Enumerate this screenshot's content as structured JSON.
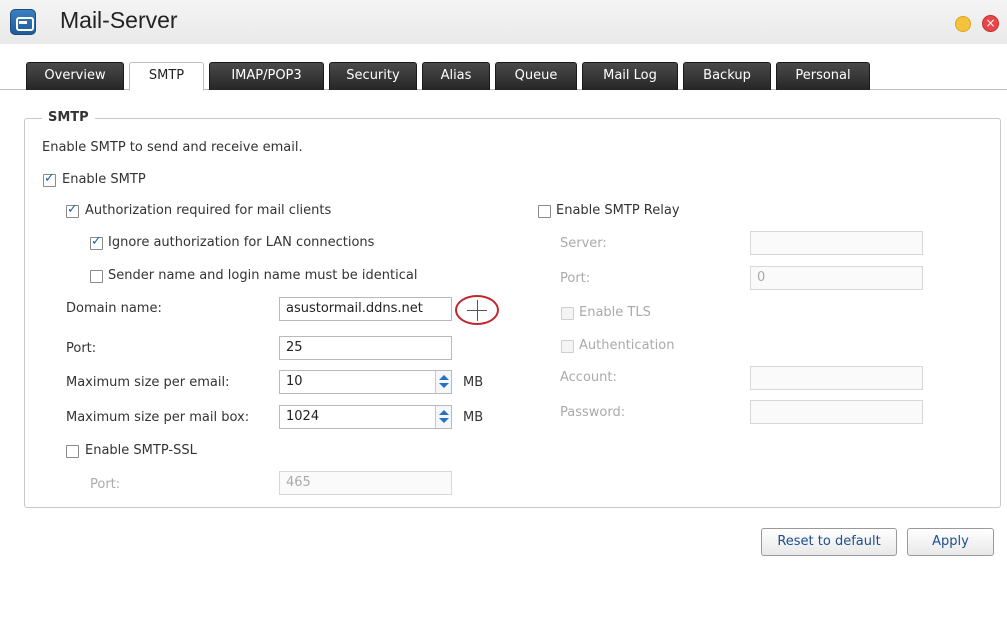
{
  "window": {
    "title": "Mail-Server",
    "close_glyph": "×"
  },
  "tabs": [
    {
      "label": "Overview"
    },
    {
      "label": "SMTP"
    },
    {
      "label": "IMAP/POP3"
    },
    {
      "label": "Security"
    },
    {
      "label": "Alias"
    },
    {
      "label": "Queue"
    },
    {
      "label": "Mail Log"
    },
    {
      "label": "Backup"
    },
    {
      "label": "Personal"
    }
  ],
  "smtp": {
    "legend": "SMTP",
    "description": "Enable SMTP to send and receive email.",
    "enable_smtp": {
      "label": "Enable SMTP",
      "checked": true
    },
    "auth_required": {
      "label": "Authorization required for mail clients",
      "checked": true
    },
    "ignore_lan": {
      "label": "Ignore authorization for LAN connections",
      "checked": true
    },
    "sender_identical": {
      "label": "Sender name and login name must be identical",
      "checked": false
    },
    "domain": {
      "label": "Domain name:",
      "value": "asustormail.ddns.net"
    },
    "port": {
      "label": "Port:",
      "value": "25"
    },
    "max_email": {
      "label": "Maximum size per email:",
      "value": "10",
      "unit": "MB"
    },
    "max_mailbox": {
      "label": "Maximum size per mail box:",
      "value": "1024",
      "unit": "MB"
    },
    "ssl": {
      "label": "Enable SMTP-SSL",
      "checked": false,
      "port_label": "Port:",
      "port_value": "465"
    }
  },
  "relay": {
    "enable": {
      "label": "Enable SMTP Relay",
      "checked": false
    },
    "server": {
      "label": "Server:",
      "value": ""
    },
    "port": {
      "label": "Port:",
      "value": "0"
    },
    "tls": {
      "label": "Enable TLS",
      "checked": false
    },
    "auth": {
      "label": "Authentication",
      "checked": false
    },
    "account": {
      "label": "Account:",
      "value": ""
    },
    "password": {
      "label": "Password:",
      "value": ""
    }
  },
  "buttons": {
    "reset": "Reset to default",
    "apply": "Apply"
  },
  "icons": {
    "app": "mail-server-icon",
    "minimize": "minimize-icon",
    "close": "close-icon",
    "add": "add-icon"
  },
  "colors": {
    "accent": "#1b63b7",
    "tab_dark": "#262626",
    "highlight_ring": "#c0272d"
  }
}
